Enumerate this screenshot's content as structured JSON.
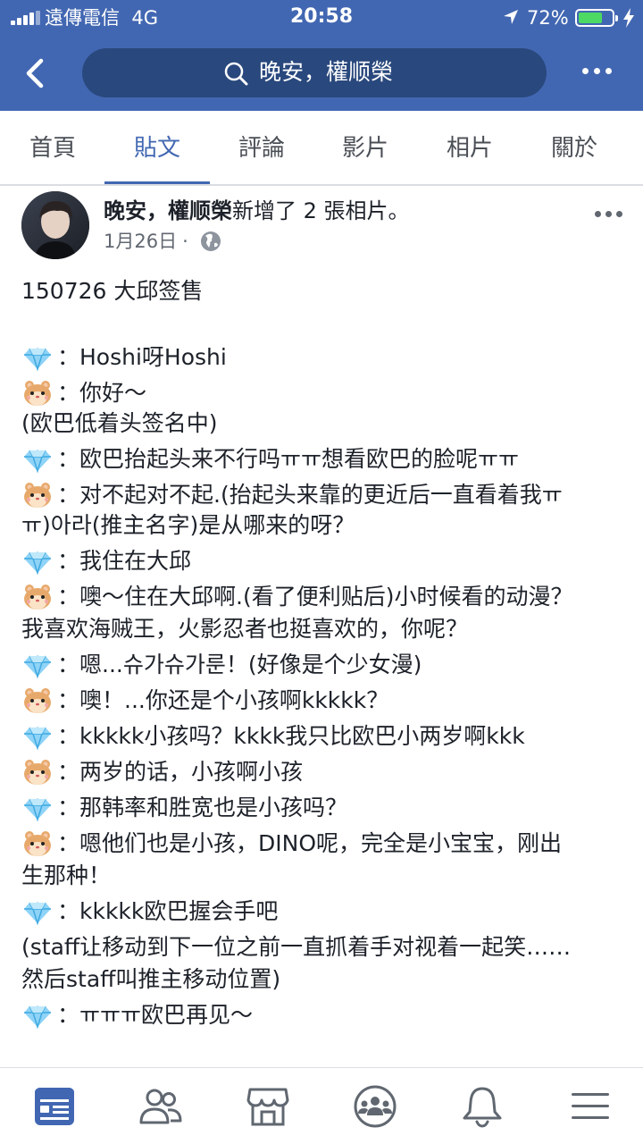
{
  "status_bar": {
    "carrier": "遠傳電信",
    "network": "4G",
    "time": "20:58",
    "battery_percent": "72%",
    "battery_level": 0.72,
    "accent_color": "#4267b2"
  },
  "header": {
    "search_text": "晚安，權顺榮",
    "icons": [
      "back-arrow-icon",
      "search-icon",
      "more-icon"
    ]
  },
  "tabs": [
    {
      "label": "首頁",
      "active": false
    },
    {
      "label": "貼文",
      "active": true
    },
    {
      "label": "評論",
      "active": false
    },
    {
      "label": "影片",
      "active": false
    },
    {
      "label": "相片",
      "active": false
    },
    {
      "label": "關於",
      "active": false
    }
  ],
  "post": {
    "author": "晚安，權顺榮",
    "action": "新增了 2 張相片。",
    "date": "1月26日",
    "dot": "·",
    "privacy_icon": "globe-icon",
    "lines": [
      {
        "emoji": "",
        "text": "150726  大邱签售"
      },
      {
        "emoji": "",
        "text": ""
      },
      {
        "emoji": "diamond",
        "text": "：Hoshi呀Hoshi"
      },
      {
        "emoji": "hamster",
        "text": "：你好～"
      },
      {
        "emoji": "",
        "text": "(欧巴低着头签名中)"
      },
      {
        "emoji": "diamond",
        "text": "：欧巴抬起头来不行吗ㅠㅠ想看欧巴的脸呢ㅠㅠ"
      },
      {
        "emoji": "hamster",
        "text": "：对不起对不起.(抬起头来靠的更近后一直看着我ㅠ"
      },
      {
        "emoji": "",
        "text": "ㅠ)아라(推主名字)是从哪来的呀？"
      },
      {
        "emoji": "diamond",
        "text": "：我住在大邱"
      },
      {
        "emoji": "hamster",
        "text": "：噢～住在大邱啊.(看了便利贴后)小时候看的动漫？"
      },
      {
        "emoji": "",
        "text": "我喜欢海贼王，火影忍者也挺喜欢的，你呢？"
      },
      {
        "emoji": "diamond",
        "text": "：嗯...슈가슈가룬！(好像是个少女漫)"
      },
      {
        "emoji": "hamster",
        "text": "：噢！...你还是个小孩啊kkkkk？"
      },
      {
        "emoji": "diamond",
        "text": "：kkkkk小孩吗？kkkk我只比欧巴小两岁啊kkk"
      },
      {
        "emoji": "hamster",
        "text": "：两岁的话，小孩啊小孩"
      },
      {
        "emoji": "diamond",
        "text": "：那韩率和胜宽也是小孩吗？"
      },
      {
        "emoji": "hamster",
        "text": "：嗯他们也是小孩，DINO呢，完全是小宝宝，刚出"
      },
      {
        "emoji": "",
        "text": "生那种！"
      },
      {
        "emoji": "diamond",
        "text": "：kkkkk欧巴握会手吧"
      },
      {
        "emoji": "",
        "text": "(staff让移动到下一位之前一直抓着手对视着一起笑……"
      },
      {
        "emoji": "",
        "text": "然后staff叫推主移动位置)"
      },
      {
        "emoji": "diamond",
        "text": "：ㅠㅠㅠ欧巴再见～"
      }
    ]
  },
  "bottom_nav": [
    {
      "icon": "news-feed-icon",
      "active": true
    },
    {
      "icon": "friends-icon",
      "active": false
    },
    {
      "icon": "marketplace-icon",
      "active": false
    },
    {
      "icon": "groups-icon",
      "active": false
    },
    {
      "icon": "notifications-bell-icon",
      "active": false
    },
    {
      "icon": "menu-icon",
      "active": false
    }
  ]
}
